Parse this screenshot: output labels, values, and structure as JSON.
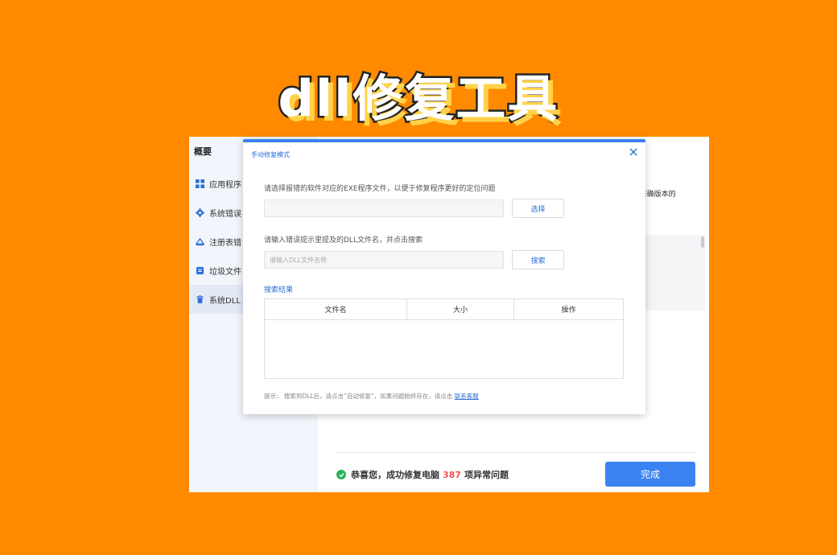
{
  "banner": {
    "title": "dll修复工具"
  },
  "colors": {
    "background": "#ff8a00",
    "accent": "#3a82f0",
    "success": "#29b35a",
    "highlight": "#f05454"
  },
  "sidebar": {
    "heading": "概要",
    "items": [
      {
        "label": "应用程序",
        "icon": "grid-icon"
      },
      {
        "label": "系统错误",
        "icon": "gear-icon"
      },
      {
        "label": "注册表错",
        "icon": "registry-icon"
      },
      {
        "label": "垃圾文件",
        "icon": "trash-file-icon"
      },
      {
        "label": "系统DLL",
        "icon": "trash-can-icon",
        "active": true
      }
    ]
  },
  "background": {
    "partial_text": "E确版本的"
  },
  "footer": {
    "success_prefix": "恭喜您，成功修复电脑",
    "success_count": "387",
    "success_suffix": "项异常问题",
    "done_label": "完成"
  },
  "dialog": {
    "title": "手动修复模式",
    "exe_instruction": "请选择报错的软件对应的EXE程序文件，以便于修复程序更好的定位问题",
    "exe_input_value": "",
    "select_label": "选择",
    "dll_instruction": "请输入错误提示里提及的DLL文件名，并点击搜索",
    "dll_input_placeholder": "请输入DLL文件名称",
    "search_label": "搜索",
    "results_title": "搜索结果",
    "columns": [
      "文件名",
      "大小",
      "操作"
    ],
    "tip_text": "提示： 搜索到DLL后，请点击“自动修复”，如果问题始终存在，请点击",
    "tip_link": "联系客服"
  }
}
